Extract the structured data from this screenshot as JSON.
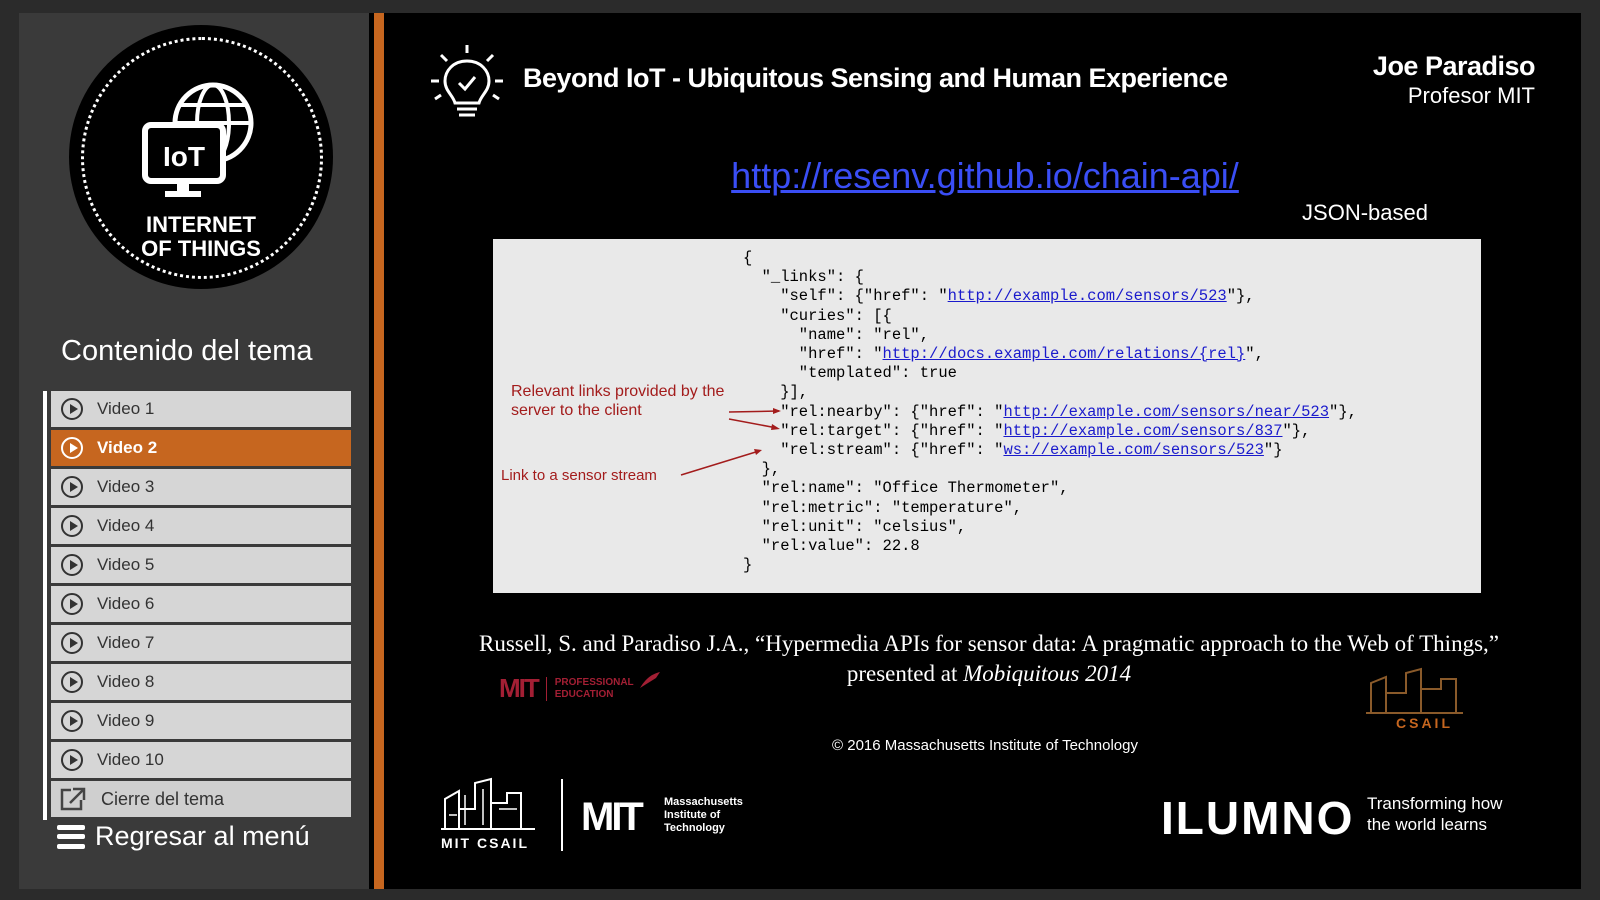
{
  "sidebar": {
    "logo": {
      "badge": "IoT",
      "line1": "INTERNET",
      "line2": "OF THINGS"
    },
    "section_title": "Contenido del tema",
    "videos": [
      {
        "label": "Video 1",
        "active": false
      },
      {
        "label": "Video 2",
        "active": true
      },
      {
        "label": "Video 3",
        "active": false
      },
      {
        "label": "Video 4",
        "active": false
      },
      {
        "label": "Video 5",
        "active": false
      },
      {
        "label": "Video 6",
        "active": false
      },
      {
        "label": "Video 7",
        "active": false
      },
      {
        "label": "Video 8",
        "active": false
      },
      {
        "label": "Video 9",
        "active": false
      },
      {
        "label": "Video 10",
        "active": false
      }
    ],
    "closing_item": "Cierre del tema",
    "back_menu": "Regresar al menú"
  },
  "slide": {
    "title": "Beyond IoT - Ubiquitous Sensing and Human Experience",
    "presenter_name": "Joe Paradiso",
    "presenter_role": "Profesor MIT",
    "link": "http://resenv.github.io/chain-api/",
    "json_label": "JSON-based",
    "code": {
      "annotation_links": "Relevant links provided by the server to the client",
      "annotation_stream": "Link to a sensor stream"
    },
    "citation_main": "Russell, S. and Paradiso J.A., “Hypermedia APIs for sensor data: A pragmatic approach to the Web of Things,” presented at ",
    "citation_venue": "Mobiquitous 2014",
    "copyright": "© 2016 Massachusetts Institute of Technology",
    "logos": {
      "mit_pe_mark": "MIT",
      "mit_pe_line1": "PROFESSIONAL",
      "mit_pe_line2": "EDUCATION",
      "csail_small": "CSAIL",
      "bottom_csail": "MIT CSAIL",
      "bottom_mit": "MIT",
      "bottom_mit_line1": "Massachusetts",
      "bottom_mit_line2": "Institute of",
      "bottom_mit_line3": "Technology",
      "ilumno": "ILUMNO",
      "ilumno_tag1": "Transforming how",
      "ilumno_tag2": "the world learns"
    }
  },
  "colors": {
    "accent": "#c6661f",
    "link": "#3a4ef5",
    "annotation": "#a31c1c"
  }
}
